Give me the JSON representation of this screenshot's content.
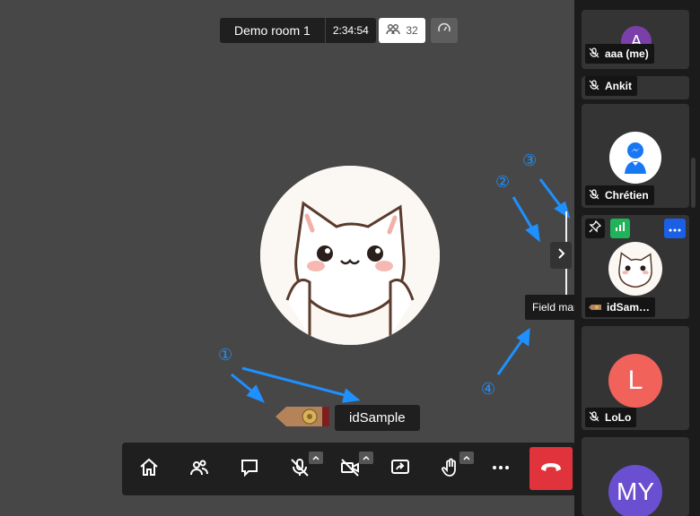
{
  "room": {
    "name": "Demo room 1",
    "timer": "2:34:54",
    "participant_count": "32"
  },
  "main": {
    "name": "idSample",
    "tooltip": "Field marshal"
  },
  "annotations": {
    "a1": "①",
    "a2": "②",
    "a3": "③",
    "a4": "④"
  },
  "sidebar": {
    "tiles": [
      {
        "label": "aaa (me)",
        "initial": "A",
        "color": "#7a3fa8"
      },
      {
        "label": "Ankit"
      },
      {
        "label": "Chrétien"
      },
      {
        "label": "idSam…"
      },
      {
        "label": "LoLo",
        "initial": "L",
        "color": "#f0625a"
      },
      {
        "initial": "MY",
        "color": "#6a4fd0"
      }
    ]
  },
  "colors": {
    "accent": "#1e90ff",
    "hangup": "#e0333b",
    "toolbar": "#1f1f1f",
    "stage": "#474747"
  }
}
